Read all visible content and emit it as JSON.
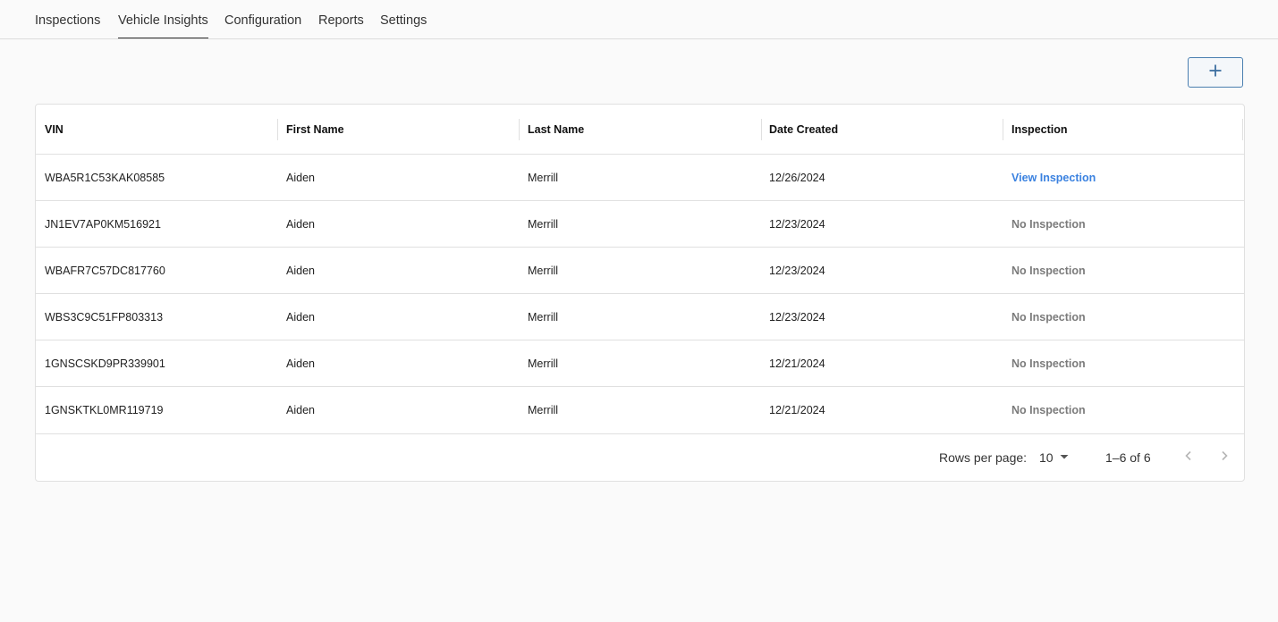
{
  "nav": {
    "tabs": [
      {
        "label": "Inspections",
        "active": false
      },
      {
        "label": "Vehicle Insights",
        "active": true
      },
      {
        "label": "Configuration",
        "active": false
      },
      {
        "label": "Reports",
        "active": false
      },
      {
        "label": "Settings",
        "active": false
      }
    ]
  },
  "toolbar": {
    "add_icon": "plus-icon"
  },
  "table": {
    "columns": [
      "VIN",
      "First Name",
      "Last Name",
      "Date Created",
      "Inspection"
    ],
    "rows": [
      {
        "vin": "WBA5R1C53KAK08585",
        "first_name": "Aiden",
        "last_name": "Merrill",
        "date_created": "12/26/2024",
        "inspection": "View Inspection",
        "has_inspection": true
      },
      {
        "vin": "JN1EV7AP0KM516921",
        "first_name": "Aiden",
        "last_name": "Merrill",
        "date_created": "12/23/2024",
        "inspection": "No Inspection",
        "has_inspection": false
      },
      {
        "vin": "WBAFR7C57DC817760",
        "first_name": "Aiden",
        "last_name": "Merrill",
        "date_created": "12/23/2024",
        "inspection": "No Inspection",
        "has_inspection": false
      },
      {
        "vin": "WBS3C9C51FP803313",
        "first_name": "Aiden",
        "last_name": "Merrill",
        "date_created": "12/23/2024",
        "inspection": "No Inspection",
        "has_inspection": false
      },
      {
        "vin": "1GNSCSKD9PR339901",
        "first_name": "Aiden",
        "last_name": "Merrill",
        "date_created": "12/21/2024",
        "inspection": "No Inspection",
        "has_inspection": false
      },
      {
        "vin": "1GNSKTKL0MR119719",
        "first_name": "Aiden",
        "last_name": "Merrill",
        "date_created": "12/21/2024",
        "inspection": "No Inspection",
        "has_inspection": false
      }
    ]
  },
  "pagination": {
    "rows_per_page_label": "Rows per page:",
    "rows_per_page_value": "10",
    "range_text": "1–6 of 6"
  },
  "colors": {
    "accent": "#3b82e0",
    "muted": "#7b7b7b",
    "button_border": "#4a7fb0"
  }
}
